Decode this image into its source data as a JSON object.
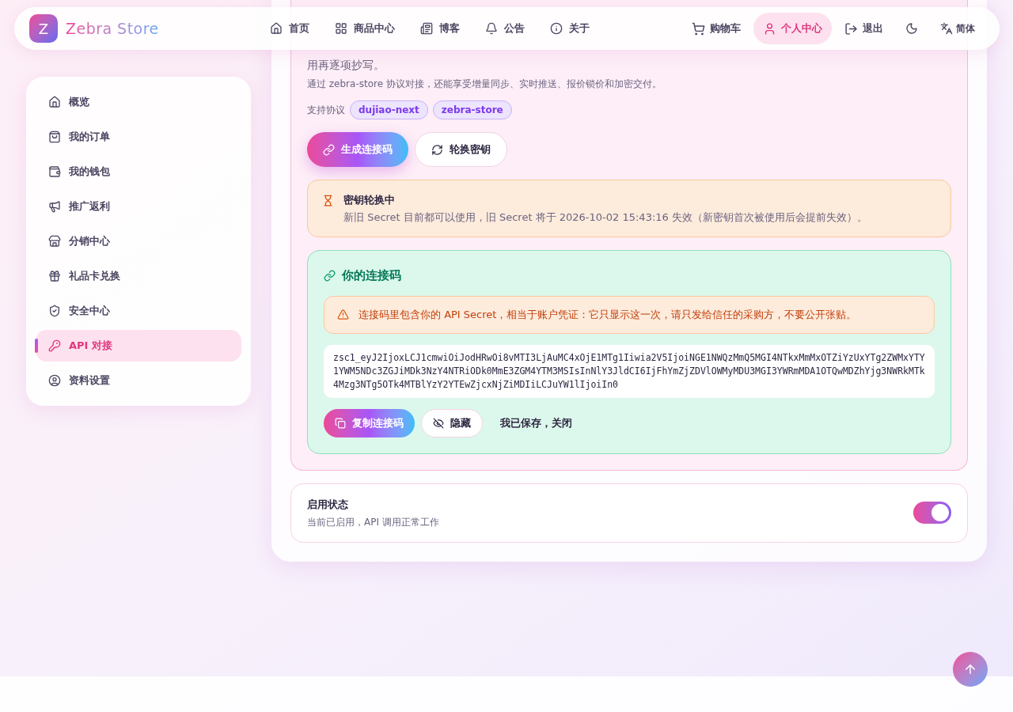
{
  "header": {
    "logo_letter": "Z",
    "brand": "Zebra Store",
    "nav": [
      {
        "label": "首页",
        "selected": false
      },
      {
        "label": "商品中心",
        "selected": false
      },
      {
        "label": "博客",
        "selected": false
      },
      {
        "label": "公告",
        "selected": false
      },
      {
        "label": "关于",
        "selected": false
      }
    ],
    "actions": [
      {
        "label": "购物车",
        "selected": false
      },
      {
        "label": "个人中心",
        "selected": true
      },
      {
        "label": "退出",
        "selected": false
      }
    ],
    "language": "简体"
  },
  "sidebar": {
    "items": [
      {
        "label": "概览",
        "selected": false
      },
      {
        "label": "我的订单",
        "selected": false
      },
      {
        "label": "我的钱包",
        "selected": false
      },
      {
        "label": "推广返利",
        "selected": false
      },
      {
        "label": "分销中心",
        "selected": false
      },
      {
        "label": "礼品卡兑换",
        "selected": false
      },
      {
        "label": "安全中心",
        "selected": false
      },
      {
        "label": "API 对接",
        "selected": true
      },
      {
        "label": "资料设置",
        "selected": false
      }
    ]
  },
  "connect": {
    "intro_tail": "用再逐项抄写。",
    "note": "通过 zebra-store 协议对接，还能享受增量同步、实时推送、报价锁价和加密交付。",
    "protocols_label": "支持协议",
    "protocols": [
      "dujiao-next",
      "zebra-store"
    ],
    "generate_button": "生成连接码",
    "rotate_button": "轮换密钥",
    "rotation": {
      "title": "密钥轮换中",
      "text": "新旧 Secret 目前都可以使用，旧 Secret 将于 2026-10-02 15:43:16 失效（新密钥首次被使用后会提前失效）。"
    },
    "code_panel": {
      "title": "你的连接码",
      "warning": "连接码里包含你的 API Secret，相当于账户凭证：它只显示这一次，请只发给信任的采购方，不要公开张贴。",
      "code": "zsc1_eyJ2IjoxLCJ1cmwiOiJodHRwOi8vMTI3LjAuMC4xOjE1MTg1Iiwia2V5IjoiNGE1NWQzMmQ5MGI4NTkxMmMxOTZiYzUxYTg2ZWMxYTY1YWM5NDc3ZGJiMDk3NzY4NTRiODk0MmE3ZGM4YTM3MSIsInNlY3JldCI6IjFhYmZjZDVlOWMyMDU3MGI3YWRmMDA1OTQwMDZhYjg3NWRkMTk4Mzg3NTg5OTk4MTBlYzY2YTEwZjcxNjZiMDIiLCJuYW1lIjoiIn0",
      "copy_button": "复制连接码",
      "hide_button": "隐藏",
      "close_button": "我已保存，关闭"
    }
  },
  "status": {
    "title": "启用状态",
    "text": "当前已启用，API 调用正常工作",
    "on": true
  }
}
